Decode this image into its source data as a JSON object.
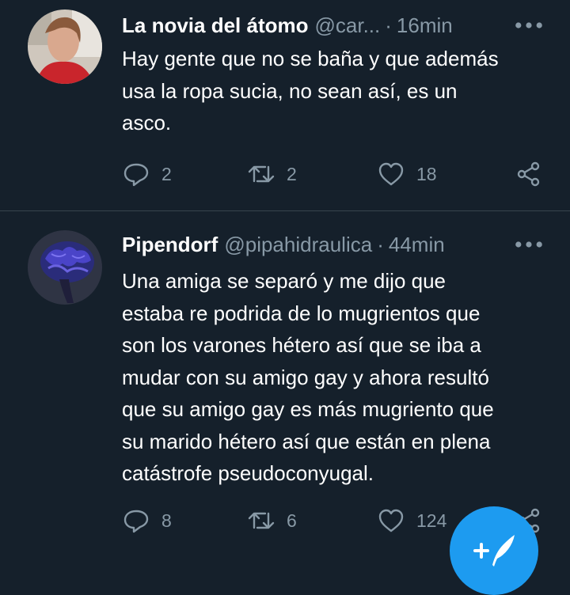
{
  "tweets": [
    {
      "author": "La novia del átomo",
      "handle": "@car...",
      "separator": "·",
      "time": "16min",
      "text": "Hay gente que no se baña y que además\nusa la ropa sucia, no sean así, es un\nasco.",
      "replies": "2",
      "retweets": "2",
      "likes": "18"
    },
    {
      "author": "Pipendorf",
      "handle": "@pipahidraulica",
      "separator": "·",
      "time": "44min",
      "text": "Una amiga se separó y me dijo que\nestaba re podrida de lo mugrientos que\nson los varones hétero así que se iba a\nmudar con su amigo gay y ahora resultó\nque su amigo gay es más mugriento que\nsu marido hétero así que están en plena\ncatástrofe pseudoconyugal.",
      "replies": "8",
      "retweets": "6",
      "likes": "124"
    }
  ],
  "icons": {
    "reply": "reply-icon",
    "retweet": "retweet-icon",
    "like": "heart-icon",
    "share": "share-icon",
    "more": "more-icon",
    "compose": "compose-tweet-icon"
  },
  "colors": {
    "background": "#15202b",
    "secondary_text": "#8899a6",
    "divider": "#38444d",
    "accent": "#1d9bf0"
  }
}
